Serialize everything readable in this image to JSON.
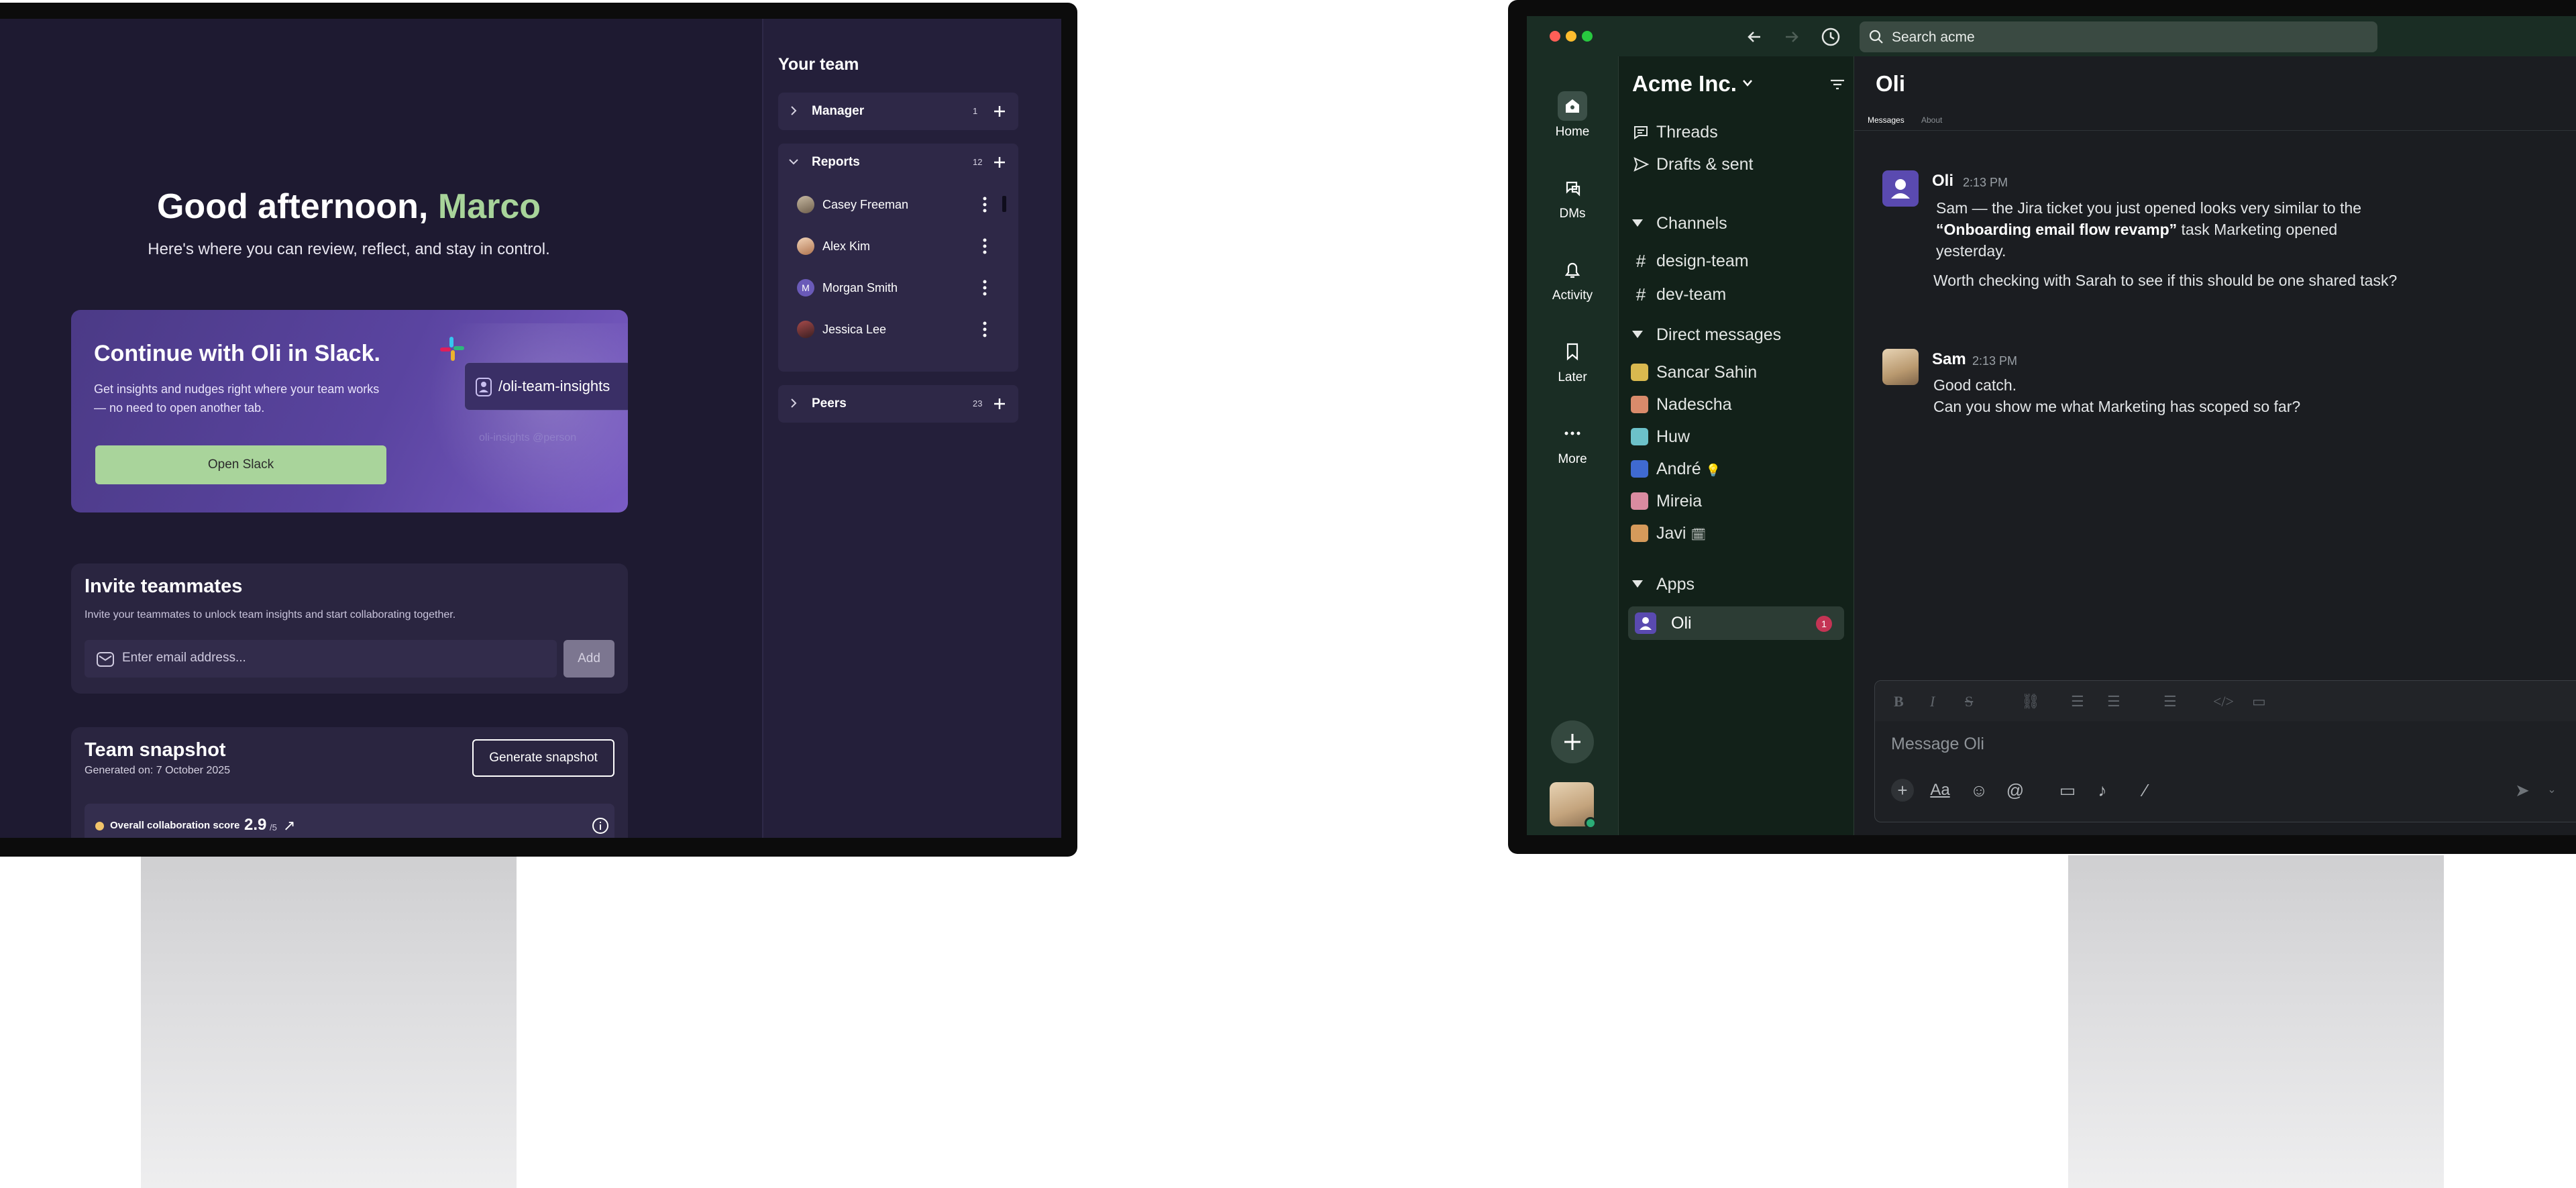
{
  "left_app": {
    "greeting": "Good afternoon,",
    "greeting_name": "Marco",
    "greeting_sub": "Here's where you can review, reflect, and stay in control.",
    "slack_card": {
      "title": "Continue with Oli in Slack.",
      "body": "Get insights and nudges right where your team works — no need to open another tab.",
      "button": "Open Slack",
      "command": "/oli-team-insights",
      "ghost": "oli-insights @person"
    },
    "invite": {
      "title": "Invite teammates",
      "body": "Invite your teammates to unlock team insights and start collaborating together.",
      "placeholder": "Enter email address...",
      "button": "Add"
    },
    "snapshot": {
      "title": "Team snapshot",
      "generated": "Generated on: 7 October 2025",
      "button": "Generate snapshot",
      "score_label": "Overall collaboration score",
      "score_value": "2.9",
      "score_of": "/5",
      "score_trend": "↗"
    },
    "team": {
      "title": "Your team",
      "groups": [
        {
          "name": "Manager",
          "count": "1"
        },
        {
          "name": "Reports",
          "count": "12"
        },
        {
          "name": "Peers",
          "count": "23"
        }
      ],
      "reports": [
        {
          "name": "Casey Freeman"
        },
        {
          "name": "Alex Kim"
        },
        {
          "name": "Morgan Smith",
          "initial": "M"
        },
        {
          "name": "Jessica Lee"
        }
      ]
    },
    "colors": {
      "accent_green": "#a8d49a",
      "card_purple": "#5a44a0"
    }
  },
  "right_app": {
    "search_placeholder": "Search acme",
    "rail": [
      {
        "label": "Home",
        "icon": "home-icon"
      },
      {
        "label": "DMs",
        "icon": "dms-icon"
      },
      {
        "label": "Activity",
        "icon": "bell-icon"
      },
      {
        "label": "Later",
        "icon": "bookmark-icon"
      },
      {
        "label": "More",
        "icon": "more-icon"
      }
    ],
    "workspace": "Acme Inc.",
    "top_items": [
      {
        "label": "Threads",
        "icon": "threads-icon"
      },
      {
        "label": "Drafts & sent",
        "icon": "send-icon"
      }
    ],
    "sections": {
      "channels": "Channels",
      "dms": "Direct messages",
      "apps": "Apps"
    },
    "channels": [
      "design-team",
      "dev-team"
    ],
    "dms": [
      {
        "name": "Sancar Sahin",
        "color": "#d9b94f"
      },
      {
        "name": "Nadescha",
        "color": "#d98b6b"
      },
      {
        "name": "Huw",
        "color": "#6cc1c9"
      },
      {
        "name": "André",
        "color": "#3f6ad1",
        "status": "💡"
      },
      {
        "name": "Mireia",
        "color": "#d98ba0"
      },
      {
        "name": "Javi",
        "color": "#d59a5b",
        "status": "🗓"
      }
    ],
    "app": {
      "name": "Oli",
      "badge": "1"
    },
    "conversation": {
      "title": "Oli",
      "tabs": [
        "Messages",
        "About"
      ],
      "messages": [
        {
          "author": "Oli",
          "time": "2:13 PM",
          "p1_pre": "Sam — the Jira ticket you just opened looks very similar to the ",
          "p1_bold": "“Onboarding email flow revamp”",
          "p1_post": " task Marketing opened yesterday.",
          "p2": "Worth checking with Sarah to see if this should be one shared task?"
        },
        {
          "author": "Sam",
          "time": "2:13 PM",
          "line1": "Good catch.",
          "line2": "Can you show me what Marketing has scoped so far?"
        }
      ],
      "composer_placeholder": "Message Oli"
    },
    "colors": {
      "sidebar": "#1a2d24",
      "badge": "#c43454",
      "online": "#2bac76"
    }
  }
}
